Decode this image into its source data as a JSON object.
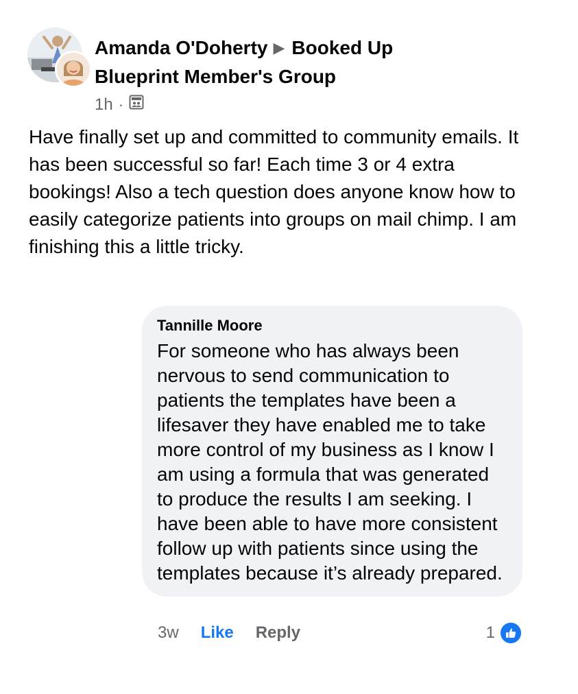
{
  "post": {
    "author_name": "Amanda O'Doherty",
    "arrow_glyph": "▶",
    "group_name": "Booked Up Blueprint Member's Group",
    "time": "1h",
    "separator": "·",
    "audience_icon": "group-audience-icon",
    "body": "Have finally set up and committed to community emails. It has been successful so far! Each time 3 or 4 extra bookings! Also a tech question does anyone know how to easily categorize patients into groups on mail chimp. I am finishing this a little tricky."
  },
  "comment": {
    "author": "Tannille Moore",
    "text": "For someone who has always been nervous to send communication to patients the templates have been a lifesaver they have enabled me to take more control of my business as I know I am using a formula that was generated to produce the results I am seeking. I have been able to have more consistent follow up with patients since using the templates because it’s already prepared.",
    "time": "3w",
    "like_label": "Like",
    "reply_label": "Reply",
    "reaction_count": "1",
    "reaction_icon": "like-reaction-icon"
  },
  "colors": {
    "accent": "#1877f2",
    "secondary_text": "#65676b",
    "bubble_bg": "#f0f2f5"
  }
}
